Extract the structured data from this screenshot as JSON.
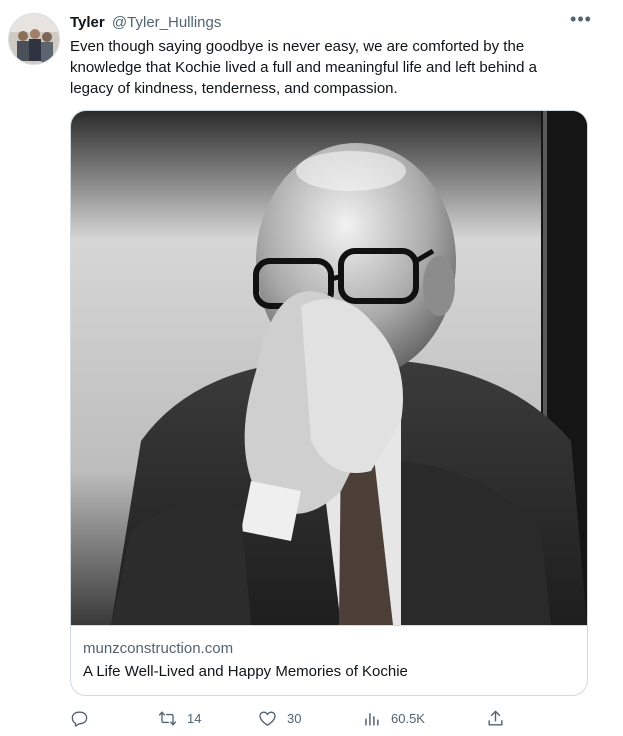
{
  "tweet": {
    "author_name": "Tyler",
    "author_handle": "@Tyler_Hullings",
    "text": "Even though saying goodbye is never easy, we are comforted by the\nknowledge that Kochie lived a full and meaningful life and left behind a\nlegacy of kindness, tenderness, and compassion."
  },
  "card": {
    "domain": "munzconstruction.com",
    "title": "A Life Well-Lived and Happy Memories of Kochie"
  },
  "actions": {
    "replies": "",
    "retweets": "14",
    "likes": "30",
    "views": "60.5K"
  },
  "icons": {
    "more": "more-icon",
    "reply": "reply-icon",
    "retweet": "retweet-icon",
    "like": "heart-icon",
    "views": "views-icon",
    "share": "share-icon"
  },
  "colors": {
    "text": "#0f1419",
    "secondary": "#536471",
    "border": "#cfd9de"
  }
}
